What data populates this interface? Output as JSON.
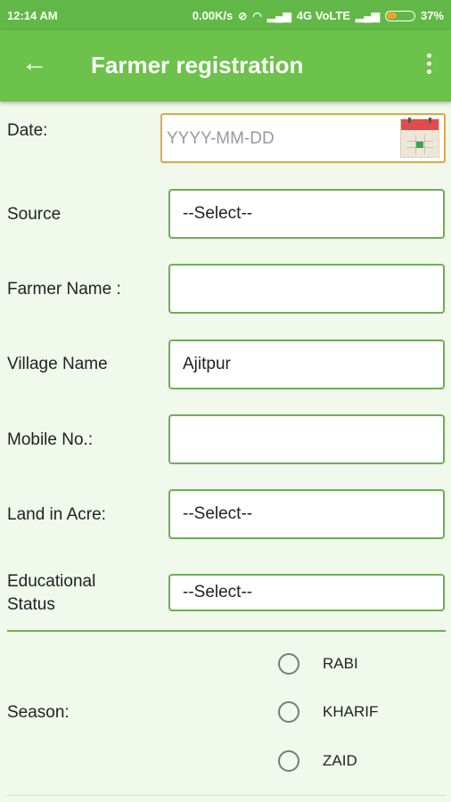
{
  "status_bar": {
    "time": "12:14 AM",
    "speed": "0.00K/s",
    "network": "4G VoLTE",
    "battery": "37%",
    "battery_level": 0.37
  },
  "app_bar": {
    "title": "Farmer registration",
    "back_icon": "back-arrow-icon",
    "menu_icon": "overflow-menu-icon"
  },
  "form": {
    "date": {
      "label": "Date:",
      "placeholder": "YYYY-MM-DD"
    },
    "source": {
      "label": "Source",
      "value": "--Select--"
    },
    "farmer_name": {
      "label": "Farmer Name :",
      "value": ""
    },
    "village_name": {
      "label": "Village Name",
      "value": "Ajitpur"
    },
    "mobile": {
      "label": "Mobile No.:",
      "value": ""
    },
    "land": {
      "label": "Land in Acre:",
      "value": "--Select--"
    },
    "education": {
      "label_line1": "Educational",
      "label_line2": "Status",
      "value": "--Select--"
    },
    "season": {
      "label": "Season:",
      "options": [
        "RABI",
        "KHARIF",
        "ZAID"
      ]
    }
  },
  "colors": {
    "app_bar": "#6cc24a",
    "status_bar": "#62b846",
    "field_border": "#6cb052",
    "date_border": "#e0a552"
  }
}
